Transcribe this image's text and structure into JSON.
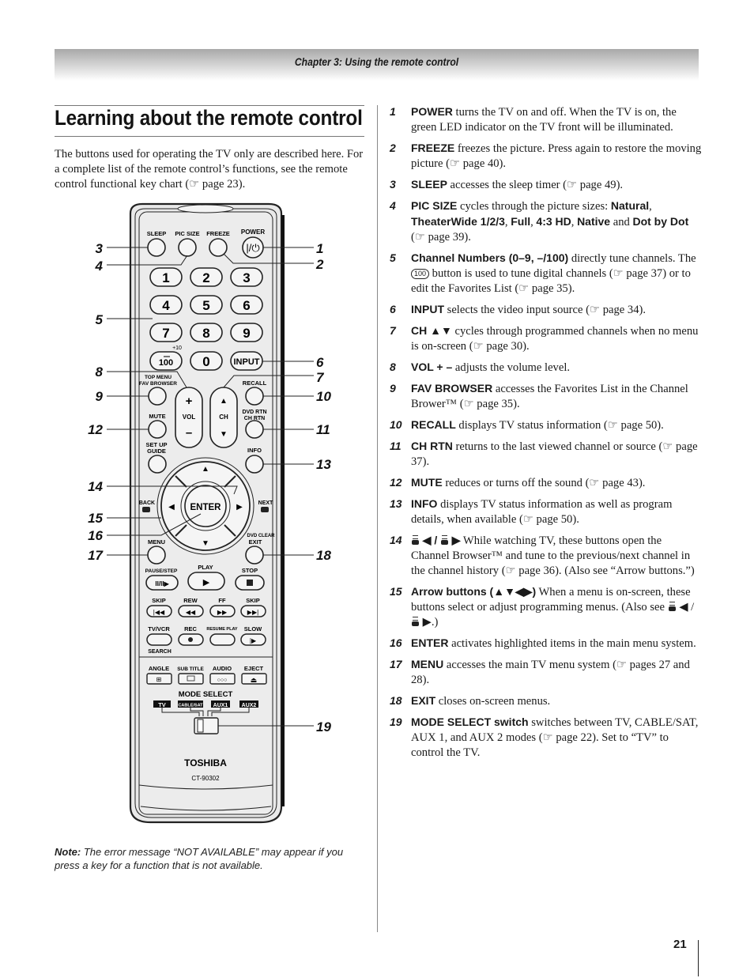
{
  "header": {
    "chapter": "Chapter 3: Using the remote control"
  },
  "page": {
    "title": "Learning about the remote control",
    "intro": "The buttons used for operating the TV only are described here. For a complete list of the remote control’s functions, see the remote control functional key chart (☞ page 23).",
    "note_label": "Note:",
    "note_text": " The error message “NOT AVAILABLE” may appear if you press a key for a function that is not available.",
    "page_number": "21"
  },
  "remote": {
    "brand": "TOSHIBA",
    "model": "CT-90302",
    "labels": {
      "sleep": "SLEEP",
      "pic_size": "PIC SIZE",
      "freeze": "FREEZE",
      "power": "POWER",
      "plus10": "+10",
      "input": "INPUT",
      "hundred": "100",
      "top_menu": "TOP MENU",
      "fav_browser": "FAV BROWSER",
      "vol": "VOL",
      "ch": "CH",
      "recall": "RECALL",
      "mute": "MUTE",
      "dvd_rtn": "DVD RTN",
      "ch_rtn": "CH RTN",
      "set_up": "SET UP",
      "guide": "GUIDE",
      "info": "INFO",
      "back": "BACK",
      "next": "NEXT",
      "enter": "ENTER",
      "menu": "MENU",
      "dvd_clear": "DVD CLEAR",
      "exit": "EXIT",
      "pause_step": "PAUSE/STEP",
      "play": "PLAY",
      "stop": "STOP",
      "skip_back": "SKIP",
      "rew": "REW",
      "ff": "FF",
      "skip_fwd": "SKIP",
      "tv_vcr": "TV/VCR",
      "rec": "REC",
      "resume_play": "RESUME PLAY",
      "slow": "SLOW",
      "search": "SEARCH",
      "angle": "ANGLE",
      "sub_title": "SUB TITLE",
      "audio": "AUDIO",
      "eject": "EJECT",
      "mode_select": "MODE SELECT",
      "mode_tv": "TV",
      "mode_cable": "CABLE/SAT",
      "mode_aux1": "AUX1",
      "mode_aux2": "AUX2"
    },
    "digits": [
      "1",
      "2",
      "3",
      "4",
      "5",
      "6",
      "7",
      "8",
      "9",
      "0"
    ],
    "callouts_left": [
      "3",
      "4",
      "5",
      "8",
      "9",
      "12",
      "14",
      "15",
      "16",
      "17"
    ],
    "callouts_right": [
      "1",
      "2",
      "6",
      "7",
      "10",
      "11",
      "13",
      "18",
      "19"
    ]
  },
  "items": [
    {
      "num": "1",
      "key": "POWER",
      "text": " turns the TV on and off. When the TV is on, the green LED indicator on the TV front will be illuminated."
    },
    {
      "num": "2",
      "key": "FREEZE",
      "text": " freezes the picture. Press again to restore the moving picture (☞ page 40)."
    },
    {
      "num": "3",
      "key": "SLEEP",
      "text": " accesses the sleep timer (☞ page 49)."
    },
    {
      "num": "4",
      "key": "PIC SIZE",
      "text": " cycles through the picture sizes: ",
      "sizes": [
        "Natural",
        "TheaterWide 1/2/3",
        "Full",
        "4:3 HD",
        "Native",
        "Dot by Dot"
      ],
      "sep": ", ",
      "and": " and ",
      "tail": " (☞ page 39)."
    },
    {
      "num": "5",
      "key": "Channel Numbers (0–9, –/100)",
      "text_a": " directly tune channels. The ",
      "icon": "100",
      "text_b": " button is used to tune digital channels (☞ page 37) or to edit the Favorites List (☞ page 35)."
    },
    {
      "num": "6",
      "key": "INPUT",
      "text": " selects the video input source (☞ page 34)."
    },
    {
      "num": "7",
      "key": "CH ▲▼",
      "text": " cycles through programmed channels when no menu is on-screen (☞ page 30)."
    },
    {
      "num": "8",
      "key": "VOL + –",
      "text": " adjusts the volume level."
    },
    {
      "num": "9",
      "key": "FAV BROWSER",
      "text": " accesses the Favorites List in the Channel Brower™ (☞ page 35)."
    },
    {
      "num": "10",
      "key": "RECALL",
      "text": " displays TV status information (☞ page 50)."
    },
    {
      "num": "11",
      "key": "CH RTN",
      "text": " returns to the last viewed channel or source (☞ page 37)."
    },
    {
      "num": "12",
      "key": "MUTE",
      "text": " reduces or turns off the sound (☞ page 43)."
    },
    {
      "num": "13",
      "key": "INFO",
      "text": " displays TV status information as well as program details, when available (☞ page 50)."
    },
    {
      "num": "14",
      "key_a": "◀ / ",
      "key_b": "▶",
      "text": " While watching TV, these buttons open the Channel Browser™ and tune to the previous/next channel in the channel history (☞ page 36). (Also see “Arrow buttons.”)"
    },
    {
      "num": "15",
      "key": "Arrow buttons (▲▼◀▶)",
      "text": " When a menu is on-screen, these buttons select or adjust programming menus. (Also see ",
      "ref_a": "◀ / ",
      "ref_b": "▶",
      "tail": ".)"
    },
    {
      "num": "16",
      "key": "ENTER",
      "text": " activates highlighted items in the main menu system."
    },
    {
      "num": "17",
      "key": "MENU",
      "text": " accesses the main TV menu system (☞ pages 27 and 28)."
    },
    {
      "num": "18",
      "key": "EXIT",
      "text": " closes on-screen menus."
    },
    {
      "num": "19",
      "key": "MODE SELECT switch",
      "text": " switches between TV, CABLE/SAT, AUX 1, and AUX 2 modes (☞ page 22). Set to “TV” to control the TV."
    }
  ]
}
